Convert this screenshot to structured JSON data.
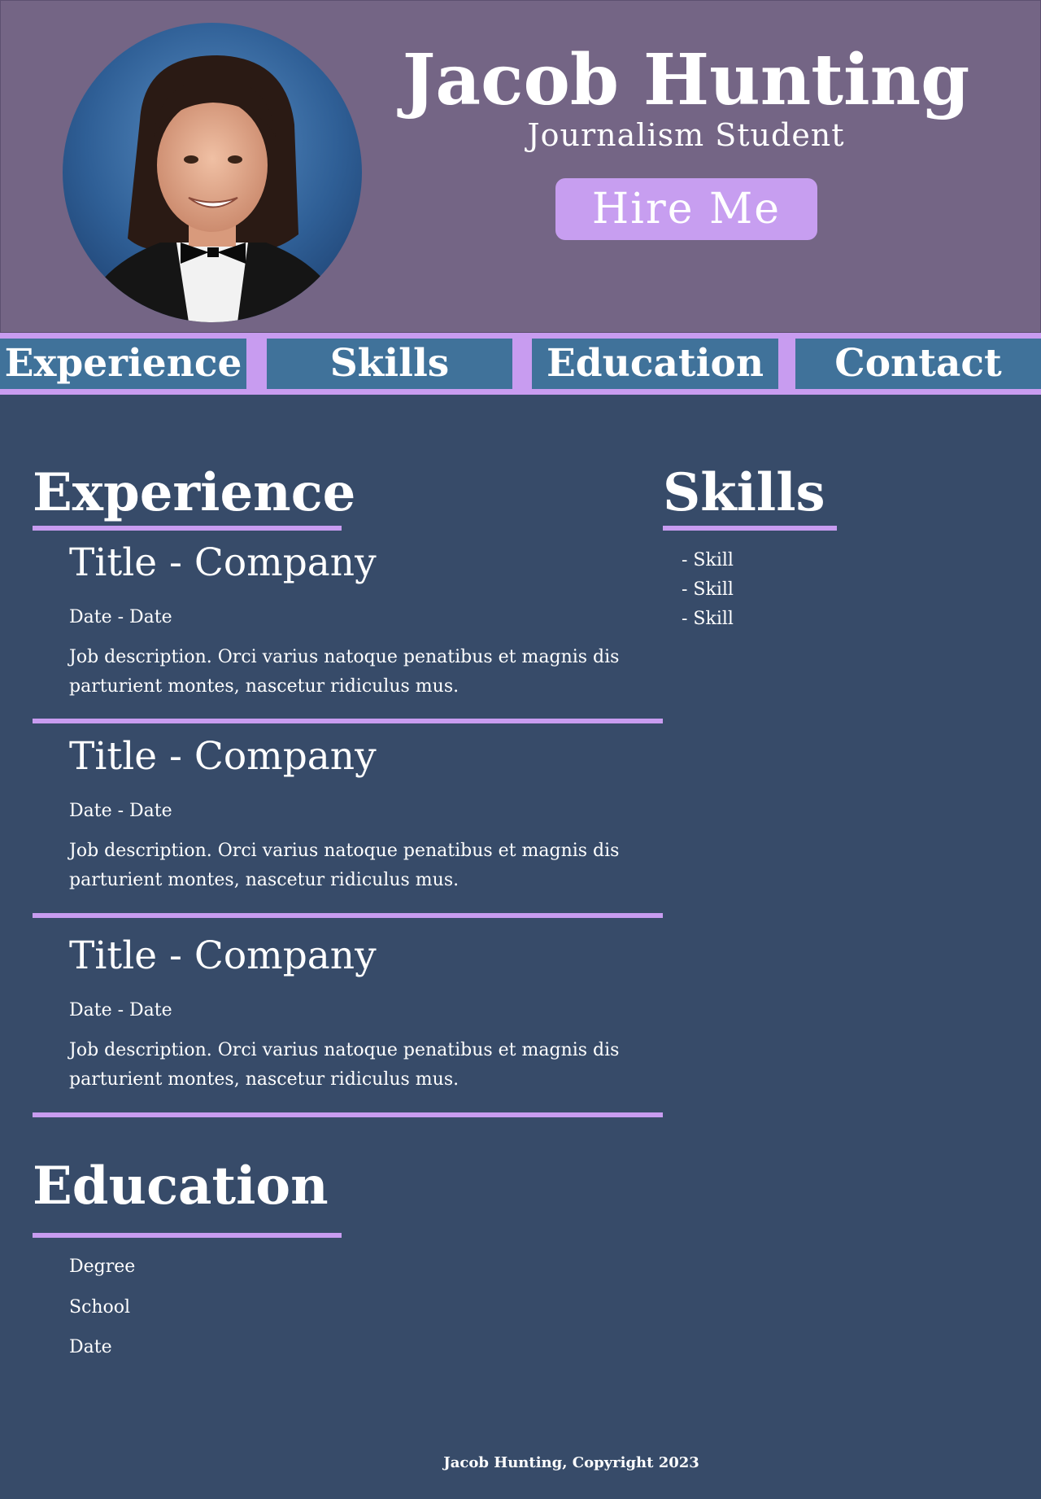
{
  "header": {
    "name": "Jacob Hunting",
    "subtitle": "Journalism Student",
    "hire_label": "Hire Me"
  },
  "nav": {
    "items": [
      {
        "label": "Experience"
      },
      {
        "label": "Skills"
      },
      {
        "label": "Education"
      },
      {
        "label": "Contact"
      }
    ]
  },
  "experience": {
    "heading": "Experience",
    "jobs": [
      {
        "title": "Title - Company",
        "dates": "Date - Date",
        "description": "Job description. Orci varius natoque penatibus et magnis dis parturient montes, nascetur ridiculus mus."
      },
      {
        "title": "Title - Company",
        "dates": "Date - Date",
        "description": "Job description. Orci varius natoque penatibus et magnis dis parturient montes, nascetur ridiculus mus."
      },
      {
        "title": "Title - Company",
        "dates": "Date - Date",
        "description": "Job description. Orci varius natoque penatibus et magnis dis parturient montes, nascetur ridiculus mus."
      }
    ]
  },
  "skills": {
    "heading": "Skills",
    "items": [
      "- Skill",
      "- Skill",
      "- Skill"
    ]
  },
  "education": {
    "heading": "Education",
    "degree": "Degree",
    "school": "School",
    "date": "Date"
  },
  "footer": {
    "text": "Jacob Hunting, Copyright 2023"
  },
  "colors": {
    "header_bg": "#746585",
    "page_bg": "#374b69",
    "accent": "#c89cf0",
    "nav_item_bg": "#40729a"
  }
}
